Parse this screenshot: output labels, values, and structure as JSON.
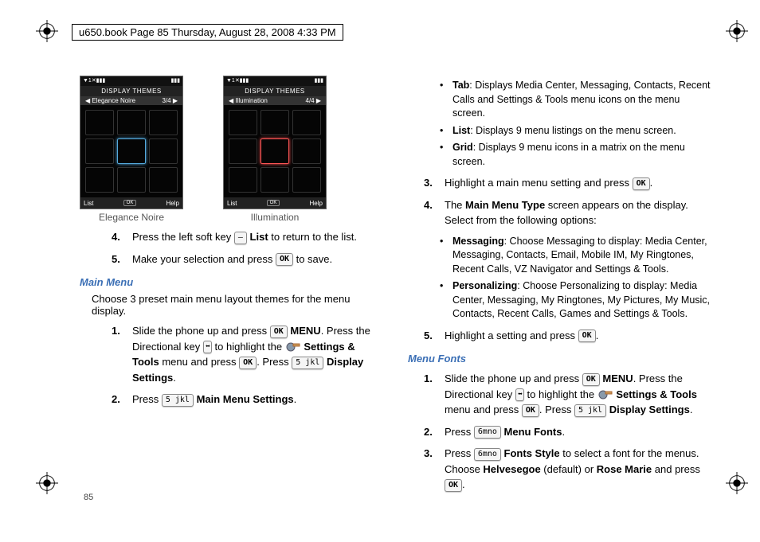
{
  "header": "u650.book  Page 85  Thursday, August 28, 2008  4:33 PM",
  "page_number": "85",
  "screens": {
    "left": {
      "status_left": "▼1✕▮▮▮",
      "status_right": "▮▮▮",
      "title": "DISPLAY THEMES",
      "sub_left": "◀ Elegance Noire",
      "sub_right": "3/4 ▶",
      "bot_left": "List",
      "bot_mid": "OK",
      "bot_right": "Help",
      "caption": "Elegance Noire"
    },
    "right": {
      "status_left": "▼1✕▮▮▮",
      "status_right": "▮▮▮",
      "title": "DISPLAY THEMES",
      "sub_left": "◀ Illumination",
      "sub_right": "4/4 ▶",
      "bot_left": "List",
      "bot_mid": "OK",
      "bot_right": "Help",
      "caption": "Illumination"
    }
  },
  "left_col": {
    "step4": {
      "n": "4.",
      "text_a": "Press the left soft key ",
      "key": "—",
      "text_b": " List",
      "text_c": " to return to the list."
    },
    "step5": {
      "n": "5.",
      "text_a": "Make your selection and press ",
      "key": "OK",
      "text_b": " to save."
    },
    "section": "Main Menu",
    "intro": "Choose 3 preset main menu layout themes for the menu display.",
    "mm_step1": {
      "n": "1.",
      "text_a": "Slide the phone up and press ",
      "key1": "OK",
      "text_b": " MENU",
      "text_c": ". Press the Directional key ",
      "key2": "⬌",
      "text_d": " to highlight the ",
      "text_e": "Settings & Tools",
      "text_f": " menu and press ",
      "key3": "OK",
      "text_g": ". Press ",
      "key4": "5 jkl",
      "text_h": "Display Settings",
      "text_i": "."
    },
    "mm_step2": {
      "n": "2.",
      "text_a": "Press ",
      "key": "5 jkl",
      "text_b": " Main Menu Settings",
      "text_c": "."
    }
  },
  "right_col": {
    "bullets": {
      "tab": {
        "label": "Tab",
        "text": ": Displays Media Center, Messaging, Contacts, Recent Calls and Settings & Tools menu icons on the menu screen."
      },
      "list": {
        "label": "List",
        "text": ": Displays 9 menu listings on the menu screen."
      },
      "grid": {
        "label": "Grid",
        "text": ": Displays 9 menu icons in a matrix on the menu screen."
      }
    },
    "step3": {
      "n": "3.",
      "text_a": "Highlight a main menu setting and press ",
      "key": "OK",
      "text_b": "."
    },
    "step4": {
      "n": "4.",
      "text_a": "The ",
      "bold": "Main Menu Type",
      "text_b": " screen appears on the display. Select from the following options:"
    },
    "bullets2": {
      "msg": {
        "label": "Messaging",
        "text": ": Choose Messaging to display: Media Center, Messaging, Contacts, Email, Mobile IM, My Ringtones, Recent Calls, VZ Navigator and Settings & Tools."
      },
      "pers": {
        "label": "Personalizing",
        "text": ": Choose Personalizing to display: Media Center, Messaging, My Ringtones, My Pictures, My  Music, Contacts, Recent Calls, Games and Settings & Tools."
      }
    },
    "step5": {
      "n": "5.",
      "text_a": "Highlight a setting and press ",
      "key": "OK",
      "text_b": "."
    },
    "section": "Menu Fonts",
    "mf_step1": {
      "n": "1.",
      "text_a": "Slide the phone up and press ",
      "key1": "OK",
      "text_b": " MENU",
      "text_c": ". Press the Directional key ",
      "key2": "⬌",
      "text_d": " to highlight the ",
      "text_e": "Settings & Tools",
      "text_f": " menu and press ",
      "key3": "OK",
      "text_g": ". Press ",
      "key4": "5 jkl",
      "text_h": "Display Settings",
      "text_i": "."
    },
    "mf_step2": {
      "n": "2.",
      "text_a": "Press ",
      "key": "6mno",
      "text_b": " Menu Fonts",
      "text_c": "."
    },
    "mf_step3": {
      "n": "3.",
      "text_a": "Press ",
      "key": "6mno",
      "text_b": " Fonts Style",
      "text_c": " to select a font for the menus. Choose ",
      "bold1": "Helvesegoe",
      "text_d": " (default) or ",
      "bold2": "Rose Marie",
      "text_e": " and press ",
      "key2": "OK",
      "text_f": "."
    }
  }
}
